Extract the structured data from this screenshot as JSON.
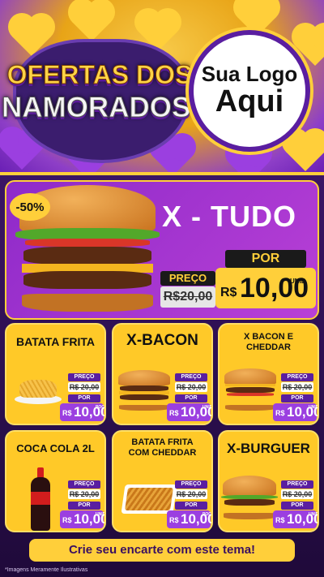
{
  "header": {
    "title_line1": "OFERTAS DOS",
    "title_line2": "NAMORADOS",
    "logo_line1": "Sua Logo",
    "logo_line2": "Aqui"
  },
  "hero": {
    "badge": "-50%",
    "name": "X - TUDO",
    "preco_label": "PREÇO",
    "old_price": "R$20,00",
    "por_label": "POR",
    "currency": "R$",
    "new_price": "10,00",
    "unit": "UNID"
  },
  "cards": [
    {
      "title": "BATATA FRITA",
      "preco_label": "PREÇO",
      "old_price": "R$ 20,00",
      "por_label": "POR",
      "currency": "R$",
      "new_price": "10,00",
      "unit": "POÇ"
    },
    {
      "title": "X-BACON",
      "preco_label": "PREÇO",
      "old_price": "R$ 20,00",
      "por_label": "POR",
      "currency": "R$",
      "new_price": "10,00",
      "unit": "UNID"
    },
    {
      "title_line1": "X BACON E",
      "title_line2": "CHEDDAR",
      "preco_label": "PREÇO",
      "old_price": "R$ 20,00",
      "por_label": "POR",
      "currency": "R$",
      "new_price": "10,00",
      "unit": "UNID"
    },
    {
      "title": "COCA COLA 2L",
      "preco_label": "PREÇO",
      "old_price": "R$ 20,00",
      "por_label": "POR",
      "currency": "R$",
      "new_price": "10,00",
      "unit": "UNID"
    },
    {
      "title_line1": "BATATA FRITA",
      "title_line2": "COM CHEDDAR",
      "preco_label": "PREÇO",
      "old_price": "R$ 20,00",
      "por_label": "POR",
      "currency": "R$",
      "new_price": "10,00",
      "unit": "POÇ"
    },
    {
      "title": "X-BURGUER",
      "preco_label": "PREÇO",
      "old_price": "R$ 20,00",
      "por_label": "POR",
      "currency": "R$",
      "new_price": "10,00",
      "unit": "UNID"
    }
  ],
  "footer": {
    "cta": "Crie seu encarte com este tema!",
    "disclaimer": "*Imagens Meramente Ilustrativas"
  }
}
